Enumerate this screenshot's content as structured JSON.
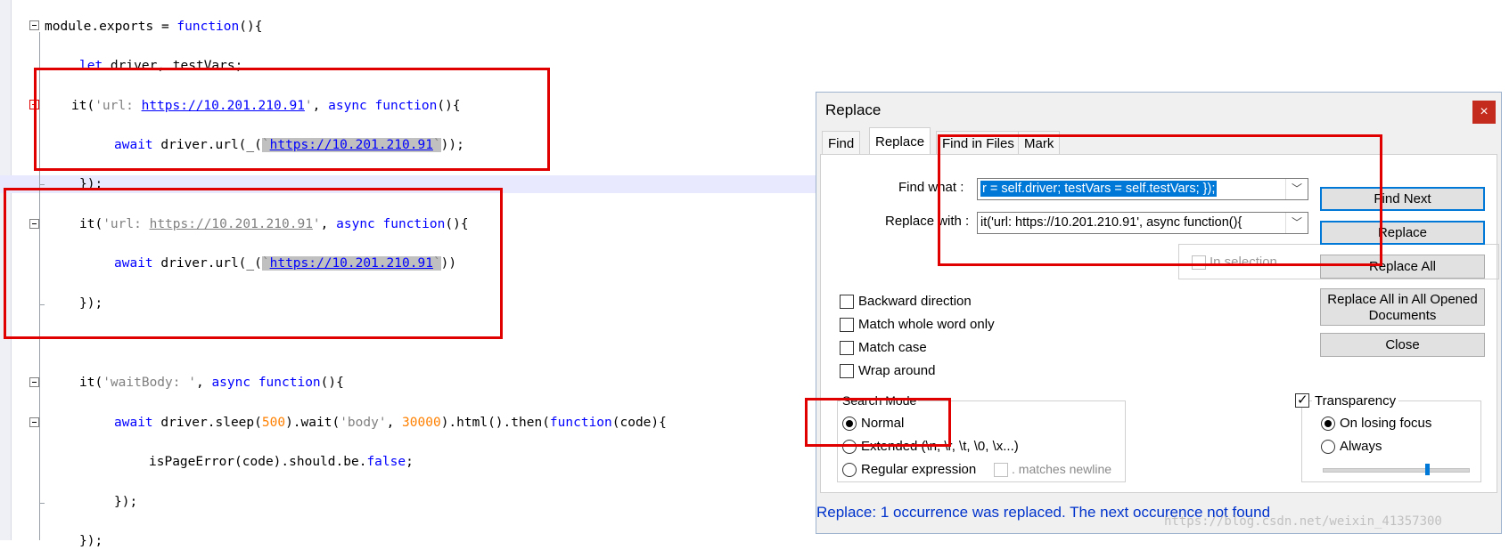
{
  "editor": {
    "lines": {
      "l1": {
        "a": "module.exports = ",
        "b": "function",
        "c": "(){"
      },
      "l2": {
        "a": "let",
        "b": " driver, testVars;"
      },
      "l3": {
        "a": "it(",
        "b": "'url: ",
        "url": "https://10.201.210.91",
        "c": "'",
        "d": ", ",
        "e": "async",
        "f": " ",
        "g": "function",
        "h": "(){"
      },
      "l4": {
        "a": "await",
        "b": " driver.url(_(",
        "c": "`",
        "url": "https://10.201.210.91",
        "d": "`",
        "e": "));"
      },
      "l5": {
        "a": "});"
      },
      "l6": {
        "a": "it(",
        "b": "'url: ",
        "url": "https://10.201.210.91",
        "c": "'",
        "d": ", ",
        "e": "async",
        "f": " ",
        "g": "function",
        "h": "(){"
      },
      "l7": {
        "a": "await",
        "b": " driver.url(_(",
        "c": "`",
        "url": "https://10.201.210.91",
        "d": "`",
        "e": "))"
      },
      "l8": {
        "a": "});"
      },
      "l9": {
        "a": "it(",
        "b": "'waitBody: '",
        "c": ", ",
        "d": "async",
        "e": " ",
        "f": "function",
        "g": "(){"
      },
      "l10": {
        "a": "await",
        "b": " driver.sleep(",
        "c": "500",
        "d": ").wait(",
        "e": "'body'",
        "f": ", ",
        "g": "30000",
        "h": ").html().then(",
        "i": "function",
        "j": "(code){"
      },
      "l11": {
        "a": "isPageError(code).should.be.",
        "b": "false",
        "c": ";"
      },
      "l12": {
        "a": "});"
      },
      "l13": {
        "a": "});"
      }
    }
  },
  "dialog": {
    "title": "Replace",
    "close_label": "×",
    "tabs": [
      "Find",
      "Replace",
      "Find in Files",
      "Mark"
    ],
    "find_what_label": "Find what :",
    "find_what_value": "r = self.driver;        testVars = self.testVars;    });",
    "replace_with_label": "Replace with :",
    "replace_with_value": "it('url: https://10.201.210.91', async function(){",
    "in_selection_label": "In selection",
    "buttons": {
      "find_next": "Find Next",
      "replace": "Replace",
      "replace_all": "Replace All",
      "replace_all_opened": "Replace All in All Opened Documents",
      "close": "Close"
    },
    "options": {
      "backward": "Backward direction",
      "whole_word": "Match whole word only",
      "match_case": "Match case",
      "wrap_around": "Wrap around"
    },
    "search_mode": {
      "title": "Search Mode",
      "normal": "Normal",
      "extended": "Extended (\\n, \\r, \\t, \\0, \\x...)",
      "regex": "Regular expression",
      "matches_newline": ". matches newline",
      "selected": "Normal"
    },
    "transparency": {
      "label": "Transparency",
      "checked": true,
      "on_losing_focus": "On losing focus",
      "always": "Always",
      "selected": "On losing focus",
      "level": 0.72
    },
    "status": "Replace: 1 occurrence was replaced. The next occurence not found"
  },
  "watermark": "https://blog.csdn.net/weixin_41357300",
  "colors": {
    "highlight_box": "#e00000",
    "keyword": "#0000ff",
    "number": "#ff8000",
    "string": "#808080",
    "status": "#0033cc"
  },
  "icons": [
    "fold-collapse-icon",
    "fold-expand-icon",
    "close-icon",
    "dropdown-arrow-icon"
  ]
}
